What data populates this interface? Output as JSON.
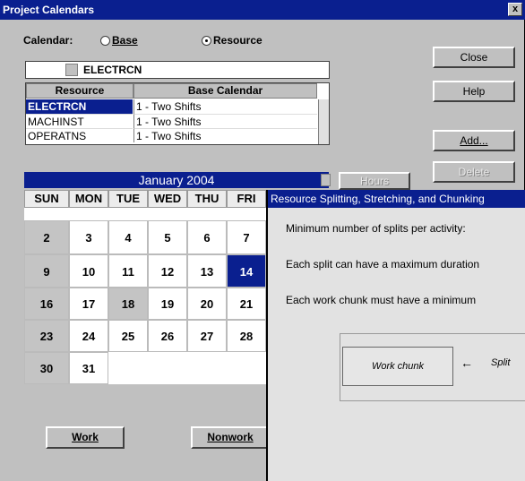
{
  "window": {
    "title": "Project Calendars",
    "close_glyph": "x"
  },
  "calendar_type": {
    "label": "Calendar:",
    "options": [
      {
        "label": "Base",
        "selected": false
      },
      {
        "label": "Resource",
        "selected": true
      }
    ]
  },
  "selector": {
    "value": "ELECTRCN"
  },
  "resource_grid": {
    "headers": [
      "Resource",
      "Base Calendar"
    ],
    "rows": [
      {
        "resource": "ELECTRCN",
        "calendar": "1 - Two Shifts",
        "selected": true
      },
      {
        "resource": "MACHINST",
        "calendar": "1 - Two Shifts",
        "selected": false
      },
      {
        "resource": "OPERATNS",
        "calendar": "1 - Two Shifts",
        "selected": false
      }
    ]
  },
  "buttons": {
    "close": "Close",
    "help": "Help",
    "add": "Add...",
    "delete": "Delete",
    "hours": "Hours",
    "work": "Work",
    "nonwork": "Nonwork"
  },
  "calendar": {
    "month_label": "January 2004",
    "day_headers": [
      "SUN",
      "MON",
      "TUE",
      "WED",
      "THU",
      "FRI"
    ],
    "weeks": [
      [
        "",
        "",
        "",
        "",
        "",
        ""
      ],
      [
        "2",
        "3",
        "4",
        "5",
        "6",
        "7"
      ],
      [
        "9",
        "10",
        "11",
        "12",
        "13",
        "14"
      ],
      [
        "16",
        "17",
        "18",
        "19",
        "20",
        "21"
      ],
      [
        "23",
        "24",
        "25",
        "26",
        "27",
        "28"
      ],
      [
        "30",
        "31",
        "",
        "",
        "",
        ""
      ]
    ],
    "selected_day": "14",
    "nonwork_days": [
      "2",
      "9",
      "16",
      "18",
      "23",
      "30"
    ]
  },
  "overlay": {
    "title": "Resource Splitting, Stretching, and Chunking",
    "line1": "Minimum number of splits per activity:",
    "line2": "Each split can have a maximum duration",
    "line3": "Each work chunk must have a minimum",
    "diagram_left": "Work chunk",
    "diagram_arrow": "←",
    "diagram_right": "Split"
  },
  "colors": {
    "title_bar": "#0a1f8f",
    "dialog_bg": "#c0c0c0",
    "selected_day": "#0a1f8f"
  }
}
